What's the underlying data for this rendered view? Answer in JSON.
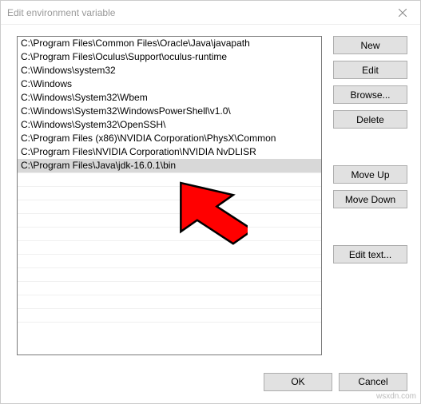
{
  "title": "Edit environment variable",
  "list": {
    "items": [
      "C:\\Program Files\\Common Files\\Oracle\\Java\\javapath",
      "C:\\Program Files\\Oculus\\Support\\oculus-runtime",
      "C:\\Windows\\system32",
      "C:\\Windows",
      "C:\\Windows\\System32\\Wbem",
      "C:\\Windows\\System32\\WindowsPowerShell\\v1.0\\",
      "C:\\Windows\\System32\\OpenSSH\\",
      "C:\\Program Files (x86)\\NVIDIA Corporation\\PhysX\\Common",
      "C:\\Program Files\\NVIDIA Corporation\\NVIDIA NvDLISR",
      "C:\\Program Files\\Java\\jdk-16.0.1\\bin"
    ],
    "selected_index": 9
  },
  "buttons": {
    "new": "New",
    "edit": "Edit",
    "browse": "Browse...",
    "delete": "Delete",
    "move_up": "Move Up",
    "move_down": "Move Down",
    "edit_text": "Edit text...",
    "ok": "OK",
    "cancel": "Cancel"
  },
  "watermark": "wsxdn.com"
}
